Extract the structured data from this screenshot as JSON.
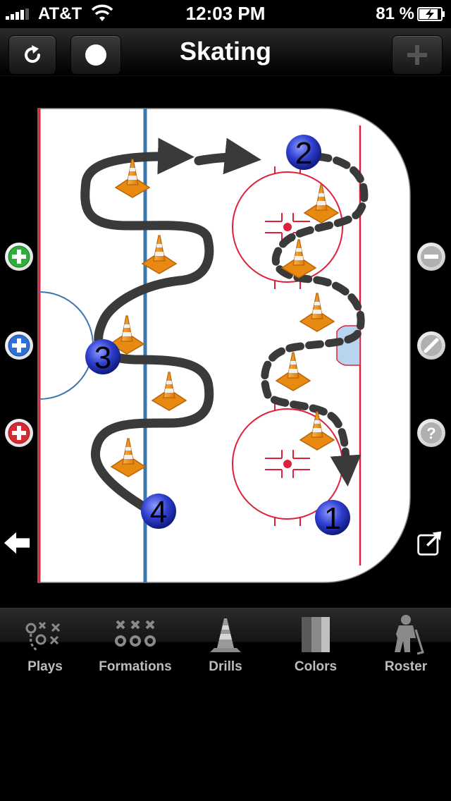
{
  "status_bar": {
    "carrier": "AT&T",
    "time": "12:03 PM",
    "battery": "81 %"
  },
  "nav": {
    "title": "Skating",
    "refresh_icon": "refresh-icon",
    "record_icon": "record-dot-icon",
    "add_icon": "plus-icon"
  },
  "rink": {
    "players": [
      {
        "label": "2"
      },
      {
        "label": "3"
      },
      {
        "label": "4"
      },
      {
        "label": "1"
      }
    ],
    "cones_count_visible": 11
  },
  "side_controls": {
    "left": [
      "green-plus-icon",
      "blue-plus-icon",
      "red-plus-icon",
      "back-arrow-icon"
    ],
    "right": [
      "minus-icon",
      "pencil-icon",
      "help-icon",
      "share-icon"
    ]
  },
  "tabs": [
    {
      "label": "Plays",
      "icon": "plays-icon"
    },
    {
      "label": "Formations",
      "icon": "formations-icon"
    },
    {
      "label": "Drills",
      "icon": "cone-icon"
    },
    {
      "label": "Colors",
      "icon": "colors-icon"
    },
    {
      "label": "Roster",
      "icon": "hockey-player-icon"
    }
  ],
  "colors": {
    "rink_line_red": "#e0203a",
    "rink_line_blue": "#3a78b0",
    "player_blue": "#2f3fcf",
    "path_dark": "#3a3a3a",
    "cone_orange": "#f59a1a"
  }
}
